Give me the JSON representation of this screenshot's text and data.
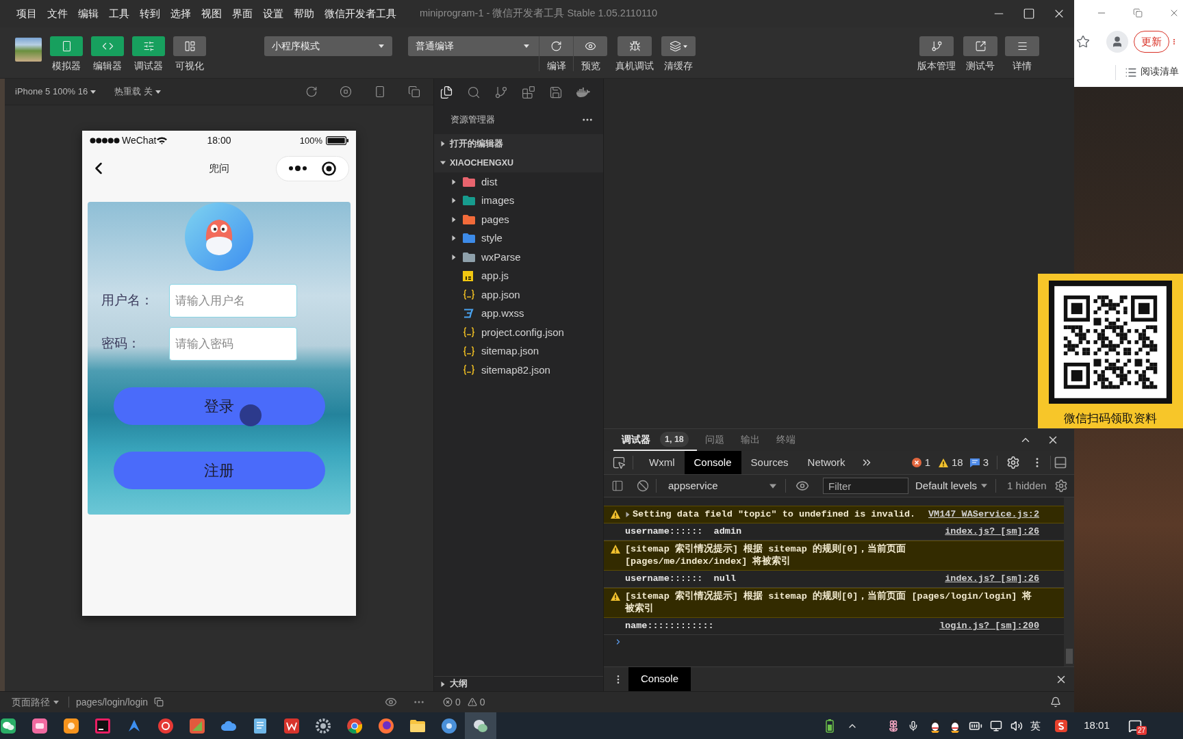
{
  "window": {
    "menu": [
      "项目",
      "文件",
      "编辑",
      "工具",
      "转到",
      "选择",
      "视图",
      "界面",
      "设置",
      "帮助",
      "微信开发者工具"
    ],
    "title": "miniprogram-1 - 微信开发者工具 Stable 1.05.2110110"
  },
  "toolbar": {
    "view_toggles": [
      {
        "kind": "simulator",
        "label": "模拟器",
        "on": true
      },
      {
        "kind": "editor",
        "label": "编辑器",
        "on": true
      },
      {
        "kind": "debugger",
        "label": "调试器",
        "on": true
      },
      {
        "kind": "visual",
        "label": "可视化",
        "on": false
      }
    ],
    "mode": "小程序模式",
    "compile": "普通编译",
    "compile_actions": [
      {
        "kind": "compile",
        "label": "编译"
      },
      {
        "kind": "preview",
        "label": "预览"
      }
    ],
    "actions": [
      {
        "kind": "remote_debug",
        "label": "真机调试"
      },
      {
        "kind": "clear_cache",
        "label": "清缓存"
      }
    ],
    "right_actions": [
      {
        "kind": "version",
        "label": "版本管理"
      },
      {
        "kind": "test_account",
        "label": "测试号"
      },
      {
        "kind": "details",
        "label": "详情"
      }
    ]
  },
  "simulator": {
    "device": "iPhone 5 100% 16",
    "hot_reload": "热重载 关",
    "phone": {
      "carrier": "WeChat",
      "time": "18:00",
      "battery": "100%",
      "title": "兜问",
      "fields": [
        {
          "label": "用户名：",
          "placeholder": "请输入用户名"
        },
        {
          "label": "密码：",
          "placeholder": "请输入密码"
        }
      ],
      "buttons": [
        "登录",
        "注册"
      ]
    }
  },
  "explorer": {
    "views": [
      {
        "kind": "files",
        "selected": true
      },
      {
        "kind": "search",
        "selected": false
      },
      {
        "kind": "git",
        "selected": false
      },
      {
        "kind": "extensions",
        "selected": false
      },
      {
        "kind": "storage",
        "selected": false
      },
      {
        "kind": "docker",
        "selected": false
      }
    ],
    "title": "资源管理器",
    "sections": [
      {
        "label": "打开的编辑器",
        "expanded": false
      },
      {
        "label": "XIAOCHENGXU",
        "expanded": true,
        "children": [
          {
            "name": "dist",
            "kind": "folder",
            "expanded": false,
            "color": "#e8646e"
          },
          {
            "name": "images",
            "kind": "folder",
            "expanded": false,
            "color": "#179c8e"
          },
          {
            "name": "pages",
            "kind": "folder",
            "expanded": false,
            "color": "#f26b3a"
          },
          {
            "name": "style",
            "kind": "folder",
            "expanded": false,
            "color": "#3d8be8"
          },
          {
            "name": "wxParse",
            "kind": "folder",
            "expanded": false,
            "color": "#8fa1ab"
          },
          {
            "name": "app.js",
            "kind": "js"
          },
          {
            "name": "app.json",
            "kind": "json"
          },
          {
            "name": "app.wxss",
            "kind": "wxss"
          },
          {
            "name": "project.config.json",
            "kind": "json"
          },
          {
            "name": "sitemap.json",
            "kind": "json"
          },
          {
            "name": "sitemap82.json",
            "kind": "json"
          }
        ]
      }
    ],
    "outline": {
      "label": "大纲",
      "expanded": false
    }
  },
  "debugger": {
    "tabs": [
      {
        "label": "调试器",
        "badge": "1, 18",
        "selected": true
      },
      {
        "label": "问题",
        "selected": false
      },
      {
        "label": "输出",
        "selected": false
      },
      {
        "label": "终端",
        "selected": false
      }
    ],
    "panels": [
      {
        "label": "Wxml",
        "selected": false
      },
      {
        "label": "Console",
        "selected": true
      },
      {
        "label": "Sources",
        "selected": false
      },
      {
        "label": "Network",
        "selected": false
      }
    ],
    "errors": "1",
    "warnings": "18",
    "info": "3",
    "context": "appservice",
    "filter_placeholder": "Filter",
    "levels": "Default levels",
    "hidden": "1 hidden",
    "messages": [
      {
        "kind": "warning",
        "expanded": false,
        "text": "Setting data field \"topic\" to undefined is invalid.",
        "source": "VM147 WAService.js:2"
      },
      {
        "kind": "log",
        "text": "username::::::  admin",
        "source": "index.js? [sm]:26"
      },
      {
        "kind": "warning",
        "text": "[sitemap 索引情况提示] 根据 sitemap 的规则[0]，当前页面 [pages/me/index/index] 将被索引"
      },
      {
        "kind": "log",
        "text": "username::::::  null",
        "source": "index.js? [sm]:26"
      },
      {
        "kind": "warning",
        "text": "[sitemap 索引情况提示] 根据 sitemap 的规则[0]，当前页面 [pages/login/login] 将被索引"
      },
      {
        "kind": "log",
        "text": "name::::::::::::",
        "source": "login.js? [sm]:200"
      }
    ],
    "drawer_tab": "Console"
  },
  "status_bar": {
    "path_label": "页面路径",
    "path": "pages/login/login",
    "errors": "0",
    "warnings": "0"
  },
  "browser": {
    "update": "更新",
    "reading_list": "阅读清单"
  },
  "promo": {
    "caption": "微信扫码领取资料"
  },
  "taskbar": {
    "apps": [
      {
        "kind": "chat",
        "selected": false
      },
      {
        "kind": "pink",
        "selected": false
      },
      {
        "kind": "orange",
        "selected": false
      },
      {
        "kind": "ide",
        "selected": false
      },
      {
        "kind": "arrow",
        "selected": false
      },
      {
        "kind": "music",
        "selected": false
      },
      {
        "kind": "paint",
        "selected": false
      },
      {
        "kind": "cloud",
        "selected": false
      },
      {
        "kind": "notebook",
        "selected": false
      },
      {
        "kind": "office",
        "selected": false
      },
      {
        "kind": "settings",
        "selected": false
      },
      {
        "kind": "browser",
        "selected": false
      },
      {
        "kind": "fox",
        "selected": false
      },
      {
        "kind": "files",
        "selected": false
      },
      {
        "kind": "globe",
        "selected": false
      },
      {
        "kind": "devtools",
        "selected": true
      }
    ],
    "ime": "英",
    "time": "18:01",
    "notifications": "27"
  }
}
